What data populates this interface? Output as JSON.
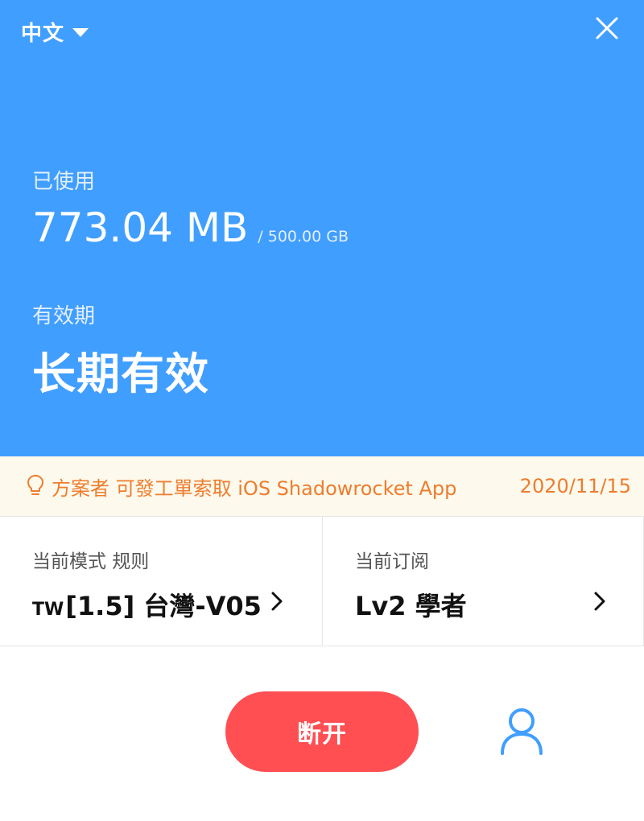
{
  "header": {
    "language": "中文",
    "usage": {
      "label": "已使用",
      "used": "773.04 MB",
      "total": "/ 500.00 GB"
    },
    "validity": {
      "label": "有效期",
      "value": "长期有效"
    }
  },
  "notice": {
    "text": "方案者 可發工單索取 iOS Shadowrocket App",
    "date": "2020/11/15"
  },
  "mode_card": {
    "label": "当前模式 规则",
    "prefix": "TW",
    "value": "[1.5] 台灣-V05"
  },
  "subscription_card": {
    "label": "当前订阅",
    "value": "Lv2 學者"
  },
  "actions": {
    "disconnect_label": "断开"
  },
  "colors": {
    "header_bg": "#409EFF",
    "notice_bg": "#FDF9EC",
    "notice_text": "#EE7D2E",
    "disconnect_bg": "#FF4F53",
    "user_icon": "#409EFF"
  },
  "icons": {
    "language_dropdown": "caret-down-icon",
    "close": "close-icon",
    "notice": "lightbulb-icon",
    "chevrons": "chevron-right-icon",
    "account": "user-icon"
  }
}
